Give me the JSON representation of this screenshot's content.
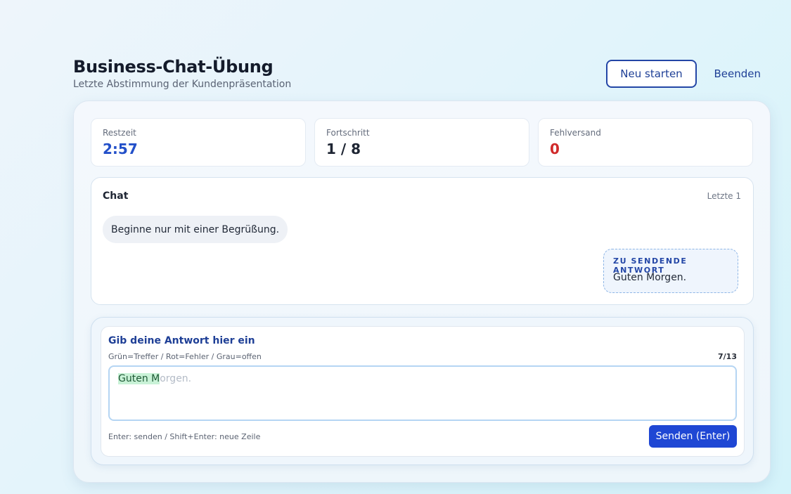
{
  "header": {
    "title": "Business-Chat-Übung",
    "subtitle": "Letzte Abstimmung der Kundenpräsentation",
    "restart_label": "Neu starten",
    "end_label": "Beenden"
  },
  "stats": [
    {
      "label": "Restzeit",
      "value": "2:57",
      "color": "#2350c9"
    },
    {
      "label": "Fortschritt",
      "value": "1 / 8",
      "color": "#1e2533"
    },
    {
      "label": "Fehlversand",
      "value": "0",
      "color": "#d02a2a"
    }
  ],
  "chat": {
    "title": "Chat",
    "count_label": "Letzte 1",
    "incoming_message": "Beginne nur mit einer Begrüßung.",
    "expected_label": "ZU SENDENDE ANTWORT",
    "expected_text": "Guten Morgen."
  },
  "input": {
    "title": "Gib deine Antwort hier ein",
    "legend": "Grün=Treffer / Rot=Fehler / Grau=offen",
    "char_count": "7/13",
    "typed_correct": "Guten M",
    "remaining": "orgen.",
    "hint": "Enter: senden / Shift+Enter: neue Zeile",
    "send_label": "Senden (Enter)"
  },
  "colors": {
    "accent": "#1f47d4",
    "brand_dark": "#1e3f96",
    "error": "#d02a2a",
    "correct_highlight": "#c9f2d7"
  }
}
